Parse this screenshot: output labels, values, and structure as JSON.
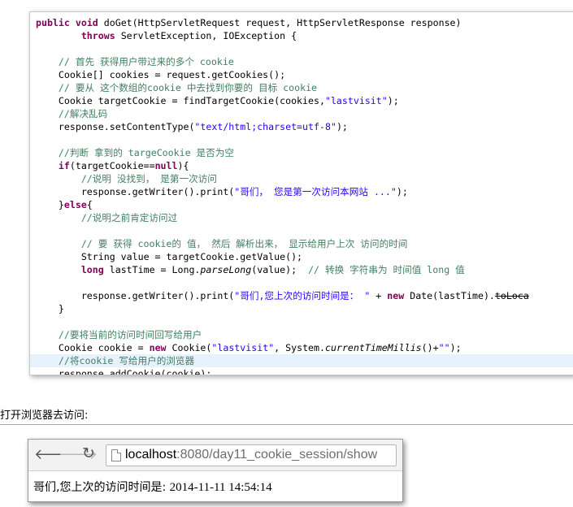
{
  "code": {
    "lines": [
      "public void doGet(HttpServletRequest request, HttpServletResponse response)",
      "        throws ServletException, IOException {",
      "",
      "    // 首先 获得用户带过来的多个 cookie",
      "    Cookie[] cookies = request.getCookies();",
      "    // 要从 这个数组的cookie 中去找到你要的 目标 cookie",
      "    Cookie targetCookie = findTargetCookie(cookies,\"lastvisit\");",
      "    //解决乱码",
      "    response.setContentType(\"text/html;charset=utf-8\");",
      "",
      "    //判断 拿到的 targeCookie 是否为空",
      "    if(targetCookie==null){",
      "        //说明 没找到， 是第一次访问",
      "        response.getWriter().print(\"哥们， 您是第一次访问本网站 ...\");",
      "    }else{",
      "        //说明之前肯定访问过",
      "",
      "        // 要 获得 cookie的 值， 然后 解析出来， 显示给用户上次 访问的时间",
      "        String value = targetCookie.getValue();",
      "        long lastTime = Long.parseLong(value);  // 转换 字符串为 时间值 long 值",
      "",
      "        response.getWriter().print(\"哥们,您上次的访问时间是： \" + new Date(lastTime).toLoca",
      "    }",
      "",
      "    //要将当前的访问时间回写给用户",
      "    Cookie cookie = new Cookie(\"lastvisit\", System.currentTimeMillis()+\"\");",
      "    //将cookie 写给用户的浏览器",
      "    response.addCookie(cookie);"
    ],
    "highlighted_line": 27
  },
  "caption": "打开浏览器去访问:",
  "browser": {
    "nav": {
      "back": "back-arrow-icon",
      "forward": "forward-arrow-icon",
      "reload": "reload-icon",
      "page": "page-icon"
    },
    "url_host": "localhost",
    "url_rest": ":8080/day11_cookie_session/show",
    "content_text": "哥们,您上次的访问时间是: ",
    "content_time": "2014-11-11 14:54:14"
  },
  "colors": {
    "keyword": "#7f0055",
    "string": "#2a00ff",
    "comment": "#3f7f5f",
    "highlight": "#e8f2fe"
  }
}
